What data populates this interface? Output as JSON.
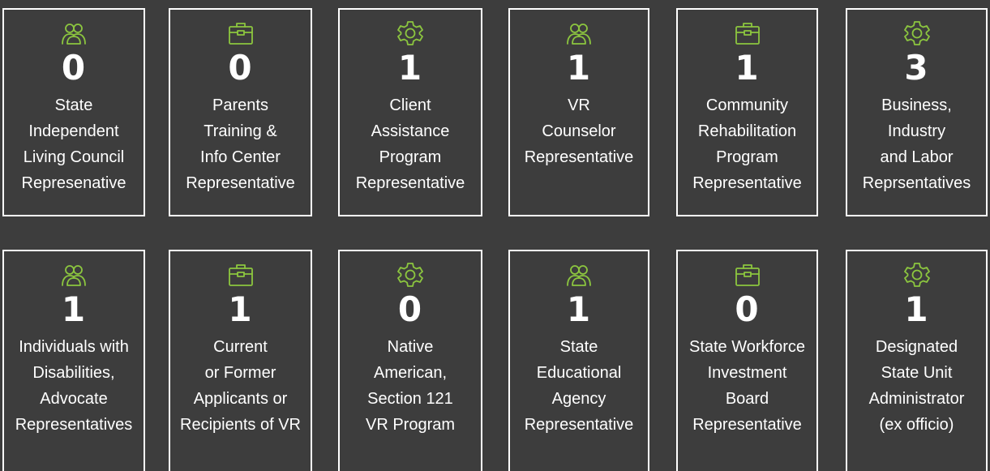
{
  "colors": {
    "background": "#3d3d3d",
    "border": "#ffffff",
    "text": "#ffffff",
    "icon": "#8cc63f"
  },
  "row1": [
    {
      "icon": "users-icon",
      "count": "0",
      "label": "State\nIndependent\nLiving Council\nRepresenative"
    },
    {
      "icon": "briefcase-icon",
      "count": "0",
      "label": "Parents\nTraining &\nInfo Center\nRepresentative"
    },
    {
      "icon": "gear-icon",
      "count": "1",
      "label": "Client\nAssistance\nProgram\nRepresentative"
    },
    {
      "icon": "users-icon",
      "count": "1",
      "label": "VR\nCounselor\nRepresentative"
    },
    {
      "icon": "briefcase-icon",
      "count": "1",
      "label": "Community\nRehabilitation\nProgram\nRepresentative"
    },
    {
      "icon": "gear-icon",
      "count": "3",
      "label": "Business,\nIndustry\nand Labor\nReprsentatives"
    }
  ],
  "row2": [
    {
      "icon": "users-icon",
      "count": "1",
      "label": "Individuals with\nDisabilities,\nAdvocate\nRepresentatives"
    },
    {
      "icon": "briefcase-icon",
      "count": "1",
      "label": "Current\nor Former\nApplicants or\nRecipients of VR"
    },
    {
      "icon": "gear-icon",
      "count": "0",
      "label": "Native\nAmerican,\nSection 121\nVR Program"
    },
    {
      "icon": "users-icon",
      "count": "1",
      "label": "State\nEducational\nAgency\nRepresentative"
    },
    {
      "icon": "briefcase-icon",
      "count": "0",
      "label": "State Workforce\nInvestment\nBoard\nRepresentative"
    },
    {
      "icon": "gear-icon",
      "count": "1",
      "label": "Designated\nState Unit\nAdministrator\n(ex officio)"
    }
  ]
}
